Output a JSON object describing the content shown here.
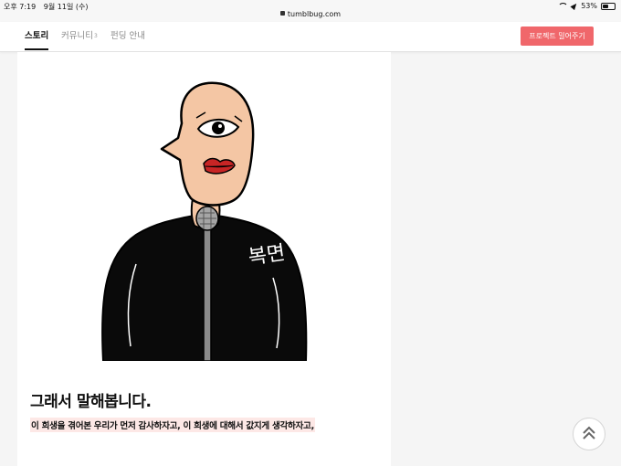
{
  "status_bar": {
    "time": "오후 7:19",
    "date": "9월 11일 (수)",
    "url": "tumblbug.com",
    "battery": "53%",
    "battery_level": 0.53
  },
  "nav": {
    "tabs": [
      {
        "label": "스토리",
        "active": true
      },
      {
        "label": "커뮤니티",
        "count": "3",
        "active": false
      },
      {
        "label": "펀딩 안내",
        "active": false
      }
    ],
    "cta_label": "프로젝트 밀어주기",
    "cta_color": "#f0676b"
  },
  "content": {
    "illustration_text": "복면",
    "heading": "그래서 말해봅니다.",
    "highlight": "이 희생을 겪어본 우리가 먼저 감사하자고, 이 희생에 대해서 값지게 생각하자고,"
  },
  "icons": {
    "scroll_top": "double-chevron-up-icon"
  }
}
